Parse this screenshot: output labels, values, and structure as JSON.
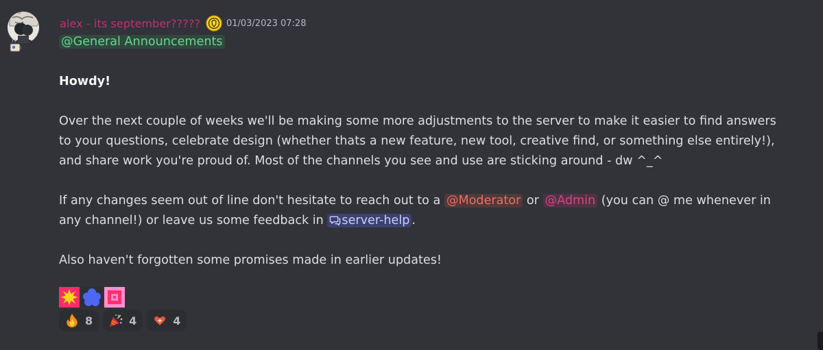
{
  "message": {
    "username": "alex - its september?????",
    "timestamp": "01/03/2023 07:28",
    "colors": {
      "username": "#c1326c",
      "background": "#313338",
      "text": "#dbdee1"
    },
    "mention_general": "@General Announcements",
    "greeting": "Howdy!",
    "para1_line1": "Over the next couple of weeks we'll be making some more adjustments to the server to make it easier to find answers",
    "para1_line2": "to your questions, celebrate design (whether thats a new feature, new tool, creative find, or something else entirely!),",
    "para1_line3": "and share work you're proud of. Most of the channels you see and use are sticking around - dw ^_^",
    "para2_prefix": "If any changes seem out of line don't hesitate to reach out to a ",
    "mention_moderator": "@Moderator",
    "para2_or": " or ",
    "mention_admin": "@Admin",
    "para2_suffix": " (you can @ me whenever in",
    "para2_line2_prefix": "any channel!) or leave us some feedback in ",
    "channel_mention": "server-help",
    "para2_end": ".",
    "para3": "Also haven't forgotten some promises made in earlier updates!"
  },
  "emotes": [
    "yellow-sunburst-emote",
    "blue-flower-emote",
    "pink-square-emote"
  ],
  "reactions": [
    {
      "icon": "fire-icon",
      "count": "8"
    },
    {
      "icon": "party-popper-icon",
      "count": "4"
    },
    {
      "icon": "sparkling-heart-icon",
      "count": "4"
    }
  ]
}
